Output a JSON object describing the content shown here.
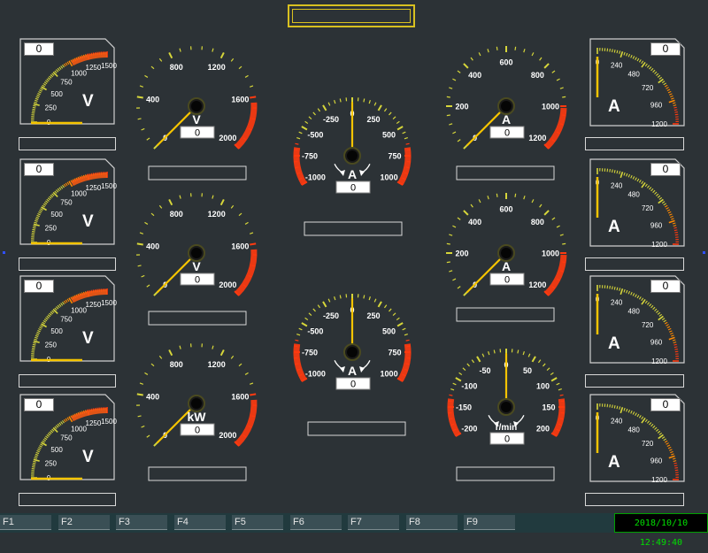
{
  "title": "",
  "colors": {
    "background": "#2c3236",
    "frame": "#d8c020",
    "needle": "#f5c400",
    "ticks": "#d6d63a",
    "red_zone": "#ff3a10",
    "orange_zone": "#ff8a00"
  },
  "left_strips": [
    {
      "value": "0",
      "unit": "V",
      "ticks": [
        "0",
        "250",
        "500",
        "750",
        "1000",
        "1250",
        "1500"
      ],
      "label": ""
    },
    {
      "value": "0",
      "unit": "V",
      "ticks": [
        "0",
        "250",
        "500",
        "750",
        "1000",
        "1250",
        "1500"
      ],
      "label": ""
    },
    {
      "value": "0",
      "unit": "V",
      "ticks": [
        "0",
        "250",
        "500",
        "750",
        "1000",
        "1250",
        "1500"
      ],
      "label": ""
    },
    {
      "value": "0",
      "unit": "V",
      "ticks": [
        "0",
        "250",
        "500",
        "750",
        "1000",
        "1250",
        "1500"
      ],
      "label": ""
    }
  ],
  "right_strips": [
    {
      "value": "0",
      "unit": "A",
      "ticks": [
        "0",
        "240",
        "480",
        "720",
        "960",
        "1200"
      ],
      "label": ""
    },
    {
      "value": "0",
      "unit": "A",
      "ticks": [
        "0",
        "240",
        "480",
        "720",
        "960",
        "1200"
      ],
      "label": ""
    },
    {
      "value": "0",
      "unit": "A",
      "ticks": [
        "0",
        "240",
        "480",
        "720",
        "960",
        "1200"
      ],
      "label": ""
    },
    {
      "value": "0",
      "unit": "A",
      "ticks": [
        "0",
        "240",
        "480",
        "720",
        "960",
        "1200"
      ],
      "label": ""
    }
  ],
  "dials": [
    {
      "value": "0",
      "unit": "V",
      "labels": [
        "0",
        "400",
        "800",
        "1200",
        "1600",
        "2000"
      ],
      "label": ""
    },
    {
      "value": "0",
      "unit": "V",
      "labels": [
        "0",
        "400",
        "800",
        "1200",
        "1600",
        "2000"
      ],
      "label": ""
    },
    {
      "value": "0",
      "unit": "kW",
      "labels": [
        "0",
        "400",
        "800",
        "1200",
        "1600",
        "2000"
      ],
      "label": ""
    },
    {
      "value": "0",
      "unit": "A",
      "labels": [
        "-1000",
        "-750",
        "-500",
        "-250",
        "0",
        "250",
        "500",
        "750",
        "1000"
      ],
      "label": ""
    },
    {
      "value": "0",
      "unit": "A",
      "labels": [
        "-1000",
        "-750",
        "-500",
        "-250",
        "0",
        "250",
        "500",
        "750",
        "1000"
      ],
      "label": ""
    },
    {
      "value": "0",
      "unit": "A",
      "labels": [
        "0",
        "200",
        "400",
        "600",
        "800",
        "1000",
        "1200"
      ],
      "label": ""
    },
    {
      "value": "0",
      "unit": "A",
      "labels": [
        "0",
        "200",
        "400",
        "600",
        "800",
        "1000",
        "1200"
      ],
      "label": ""
    },
    {
      "value": "0",
      "unit": "r/min",
      "labels": [
        "-200",
        "-150",
        "-100",
        "-50",
        "0",
        "50",
        "100",
        "150",
        "200"
      ],
      "label": ""
    }
  ],
  "function_keys": [
    "F1",
    "F2",
    "F3",
    "F4",
    "F5",
    "F6",
    "F7",
    "F8",
    "F9"
  ],
  "clock": "2018/10/10 12:49:40"
}
